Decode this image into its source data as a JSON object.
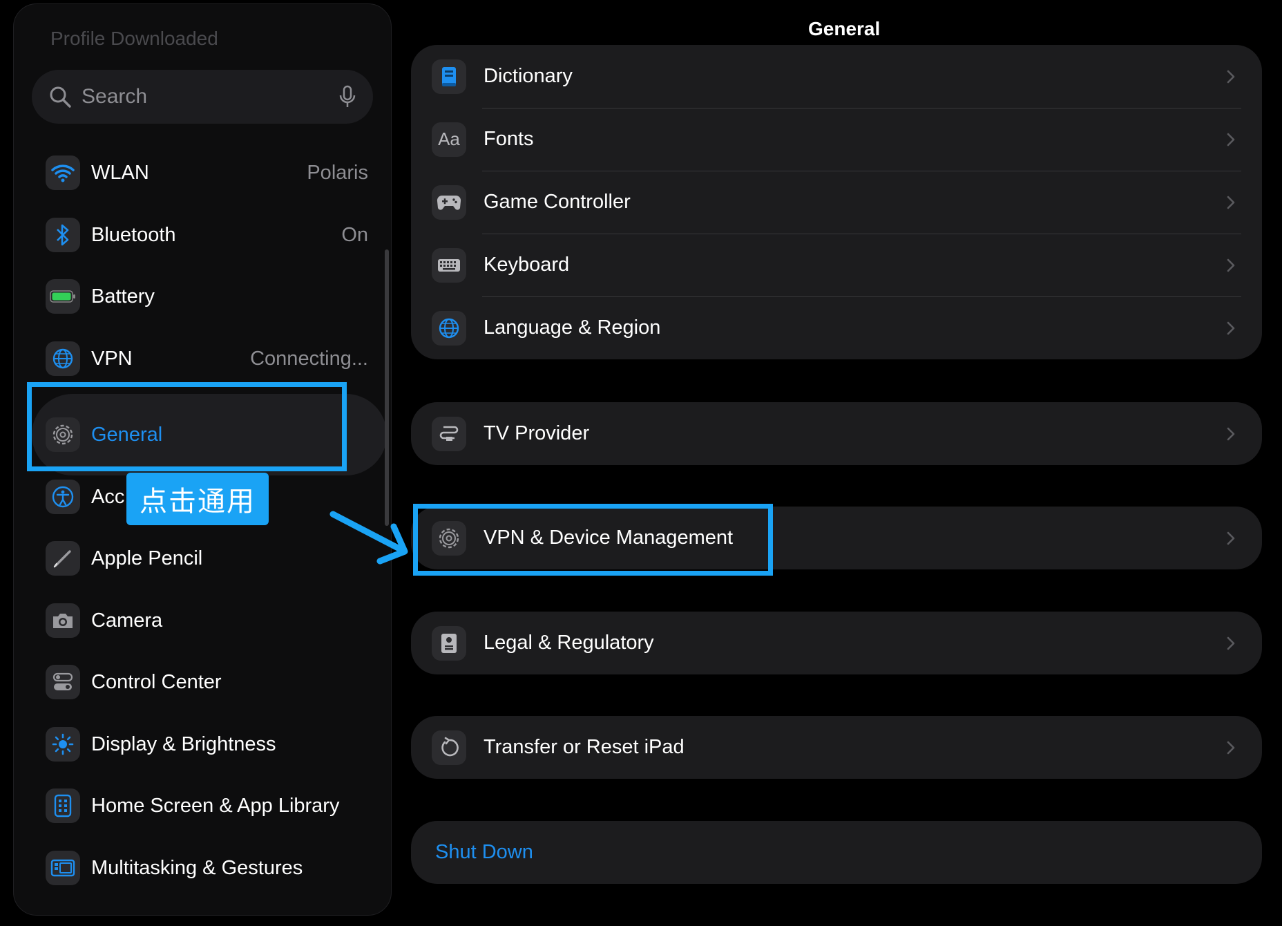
{
  "sidebar": {
    "header": "Profile Downloaded",
    "search_placeholder": "Search",
    "items": [
      {
        "label": "WLAN",
        "value": "Polaris"
      },
      {
        "label": "Bluetooth",
        "value": "On"
      },
      {
        "label": "Battery"
      },
      {
        "label": "VPN",
        "value": "Connecting..."
      },
      {
        "label": "General"
      },
      {
        "label": "Acc"
      },
      {
        "label": "Apple Pencil"
      },
      {
        "label": "Camera"
      },
      {
        "label": "Control Center"
      },
      {
        "label": "Display & Brightness"
      },
      {
        "label": "Home Screen & App Library"
      },
      {
        "label": "Multitasking & Gestures"
      }
    ]
  },
  "annotation": {
    "callout": "点击通用"
  },
  "main": {
    "title": "General",
    "group1": [
      "Dictionary",
      "Fonts",
      "Game Controller",
      "Keyboard",
      "Language & Region"
    ],
    "group2": [
      "TV Provider"
    ],
    "group3": [
      "VPN & Device Management"
    ],
    "group4": [
      "Legal & Regulatory"
    ],
    "group5": [
      "Transfer or Reset iPad"
    ],
    "shutdown": "Shut Down",
    "fonts_icon_text": "Aa"
  },
  "colors": {
    "accent": "#1e8ff0",
    "highlight": "#1aa3f5",
    "battery": "#33d158"
  },
  "icons": [
    "search-icon",
    "mic-icon",
    "wifi-icon",
    "bluetooth-icon",
    "battery-icon",
    "globe-icon",
    "gear-icon",
    "accessibility-icon",
    "pencil-icon",
    "camera-icon",
    "toggles-icon",
    "sun-icon",
    "home-screen-icon",
    "multitasking-icon",
    "book-icon",
    "gamepad-icon",
    "keyboard-icon",
    "tv-provider-icon",
    "legal-icon",
    "reset-icon",
    "chevron-right-icon"
  ]
}
